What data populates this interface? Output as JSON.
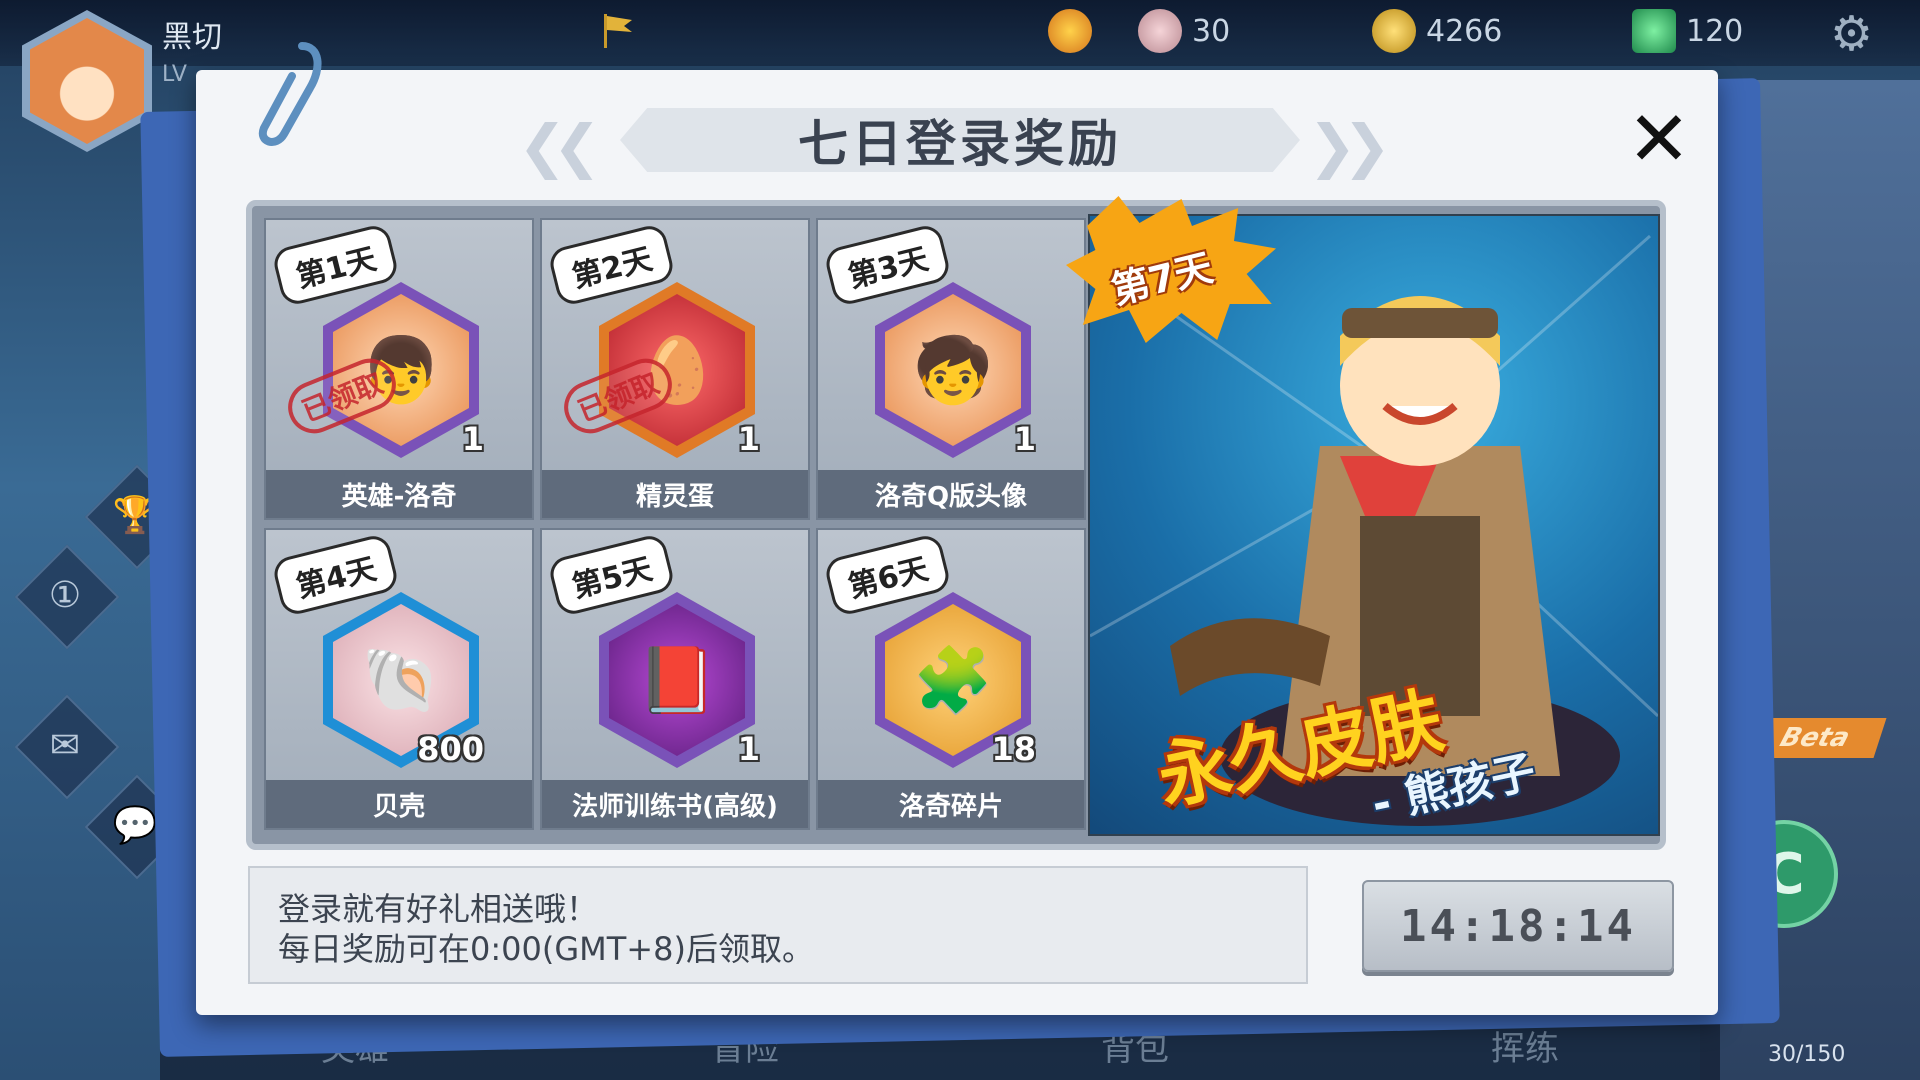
{
  "hud": {
    "player_name": "黑切",
    "player_level_prefix": "LV",
    "shells": "30",
    "gold": "4266",
    "gems": "120",
    "bag_count": "30/150",
    "beta_label": "Beta",
    "c_button_label": "C"
  },
  "bottom_nav": [
    "英雄",
    "冒险",
    "背包",
    "挥练"
  ],
  "dialog": {
    "title": "七日登录奖励",
    "close_label": "✕",
    "claimed_stamp": "已领取",
    "days": [
      {
        "badge": "第1天",
        "name": "英雄-洛奇",
        "qty": "1",
        "claimed": true,
        "frame_color": "#7a52b8",
        "icon": "hero-portrait-icon"
      },
      {
        "badge": "第2天",
        "name": "精灵蛋",
        "qty": "1",
        "claimed": true,
        "frame_color": "#e07a26",
        "icon": "spirit-egg-icon"
      },
      {
        "badge": "第3天",
        "name": "洛奇Q版头像",
        "qty": "1",
        "claimed": false,
        "frame_color": "#7a52b8",
        "icon": "chibi-avatar-icon"
      },
      {
        "badge": "第4天",
        "name": "贝壳",
        "qty": "800",
        "claimed": false,
        "frame_color": "#1f8fd6",
        "icon": "shell-icon"
      },
      {
        "badge": "第5天",
        "name": "法师训练书(高级)",
        "qty": "1",
        "claimed": false,
        "frame_color": "#7a52b8",
        "icon": "training-book-icon"
      },
      {
        "badge": "第6天",
        "name": "洛奇碎片",
        "qty": "18",
        "claimed": false,
        "frame_color": "#7a52b8",
        "icon": "puzzle-fragment-icon"
      }
    ],
    "day7": {
      "badge": "第7天",
      "reward_title": "永久皮肤",
      "reward_subtitle": "- 熊孩子"
    },
    "info_lines": [
      "登录就有好礼相送哦！",
      "每日奖励可在0:00(GMT+8)后领取。"
    ],
    "timer": "14:18:14"
  },
  "colors": {
    "dialog_bg": "#f3f5f8",
    "dialog_shadow": "#3d67b5",
    "stamp_red": "#c6262e",
    "day7_badge_orange": "#f7a514",
    "skin_title_yellow": "#ffd21f"
  }
}
